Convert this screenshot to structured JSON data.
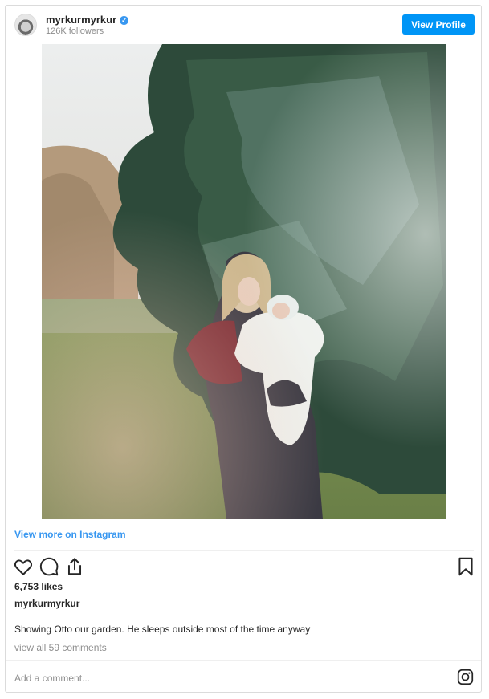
{
  "header": {
    "username": "myrkurmyrkur",
    "verified_mark": "✓",
    "followers": "126K followers",
    "view_profile_label": "View Profile"
  },
  "media": {
    "icon": "photo"
  },
  "view_more_label": "View more on Instagram",
  "actions": {
    "icons": [
      "heart-icon",
      "comment-icon",
      "share-icon",
      "bookmark-icon"
    ]
  },
  "likes": "6,753 likes",
  "owner": "myrkurmyrkur",
  "caption": "Showing Otto our garden. He sleeps outside most of the time anyway",
  "view_comments_label": "view all 59 comments",
  "comment_input": {
    "placeholder": "Add a comment..."
  },
  "colors": {
    "accent": "#3897f0",
    "button": "#0095f6",
    "muted": "#8e8e8e",
    "text": "#262626"
  }
}
